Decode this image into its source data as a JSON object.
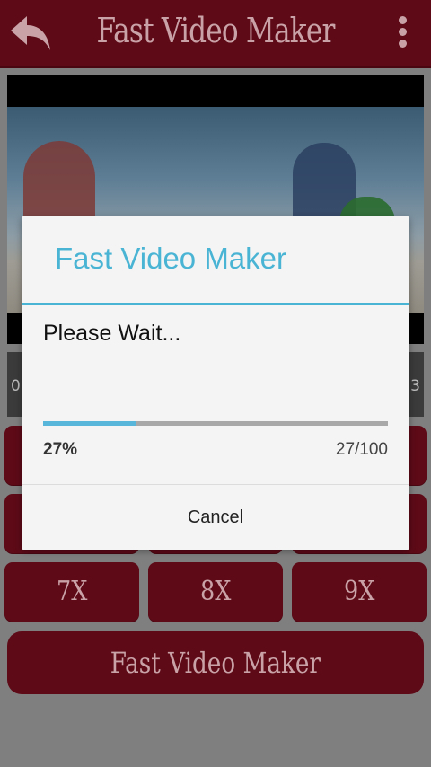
{
  "app": {
    "title": "Fast Video Maker",
    "back_icon": "back-arrow-icon",
    "menu_icon": "overflow-menu-icon",
    "bar_color": "#5e0a17",
    "title_color": "#c9a2a7"
  },
  "video": {
    "time_left": "0",
    "time_right": "3"
  },
  "speed_buttons": {
    "row3": [
      "7X",
      "8X",
      "9X"
    ]
  },
  "bottom_button_label": "Fast Video Maker",
  "dialog": {
    "title": "Fast Video Maker",
    "message": "Please Wait...",
    "progress_fraction": 0.27,
    "progress_percent_label": "27%",
    "progress_count_label": "27/100",
    "cancel_label": "Cancel",
    "accent_color": "#4ab4d4"
  }
}
